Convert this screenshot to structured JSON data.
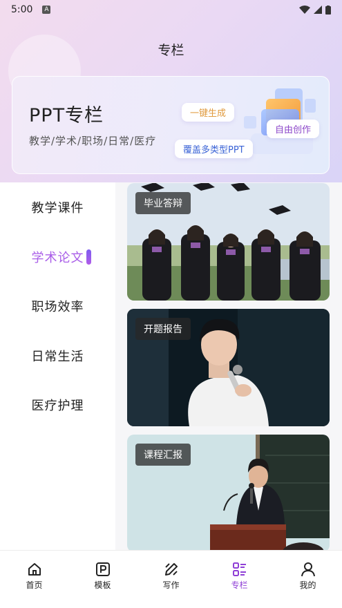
{
  "status_bar": {
    "time": "5:00",
    "notification_icon": "A"
  },
  "header": {
    "title": "专栏"
  },
  "banner": {
    "title": "PPT专栏",
    "subtitle": "教学/学术/职场/日常/医疗",
    "tags": [
      "一键生成",
      "自由创作",
      "覆盖多类型PPT"
    ],
    "colors": {
      "tag1": "#e09a3d",
      "tag2": "#8b45c9",
      "tag3": "#3a63d6"
    }
  },
  "sidebar": {
    "items": [
      {
        "label": "教学课件"
      },
      {
        "label": "学术论文"
      },
      {
        "label": "职场效率"
      },
      {
        "label": "日常生活"
      },
      {
        "label": "医疗护理"
      }
    ],
    "active_label": "学术论文",
    "accent_color": "#a95ee8"
  },
  "cards": [
    {
      "label": "毕业答辩",
      "image": "graduation-photo"
    },
    {
      "label": "开题报告",
      "image": "speaker-with-microphone-photo"
    },
    {
      "label": "课程汇报",
      "image": "lecturer-at-podium-photo"
    }
  ],
  "bottom_nav": {
    "items": [
      {
        "label": "首页",
        "icon": "home-icon"
      },
      {
        "label": "模板",
        "icon": "template-icon"
      },
      {
        "label": "写作",
        "icon": "pencil-icon"
      },
      {
        "label": "专栏",
        "icon": "column-list-icon"
      },
      {
        "label": "我的",
        "icon": "user-icon"
      }
    ],
    "active_label": "专栏",
    "accent_color": "#8f3fd6"
  }
}
